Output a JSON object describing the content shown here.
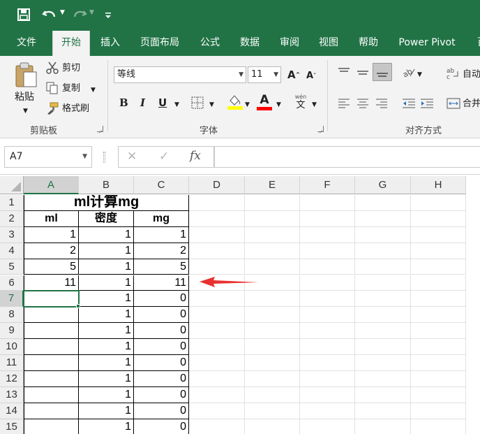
{
  "quick_access": {
    "save_icon": "save-icon",
    "undo_icon": "undo-icon",
    "redo_icon": "redo-icon",
    "customize_icon": "customize-qat-icon"
  },
  "tabs": [
    "文件",
    "开始",
    "插入",
    "页面布局",
    "公式",
    "数据",
    "审阅",
    "视图",
    "帮助",
    "Power Pivot",
    "百"
  ],
  "active_tab": "开始",
  "ribbon": {
    "clipboard": {
      "paste": "粘贴",
      "cut": "剪切",
      "copy": "复制",
      "format_painter": "格式刷",
      "label": "剪贴板"
    },
    "font": {
      "font_name": "等线",
      "font_size": "11",
      "bold": "B",
      "italic": "I",
      "underline": "U",
      "phonetic": "文",
      "phonetic_top": "wén",
      "label": "字体",
      "grow": "A",
      "shrink": "A",
      "font_color_letter": "A"
    },
    "alignment": {
      "wrap": "自动",
      "merge": "合并",
      "label": "对齐方式"
    },
    "colors": {
      "fill_highlight": "#ffff00",
      "font_color": "#ff0000"
    }
  },
  "formula_bar": {
    "name_box": "A7",
    "cancel": "✕",
    "enter": "✓",
    "fx": "fx",
    "formula": ""
  },
  "columns": [
    "A",
    "B",
    "C",
    "D",
    "E",
    "F",
    "G",
    "H"
  ],
  "rows": [
    "1",
    "2",
    "3",
    "4",
    "5",
    "6",
    "7",
    "8",
    "9",
    "10",
    "11",
    "12",
    "13",
    "14",
    "15"
  ],
  "sheet": {
    "title": "ml计算mg",
    "headers": [
      "ml",
      "密度",
      "mg"
    ],
    "data": [
      [
        "1",
        "1",
        "1"
      ],
      [
        "2",
        "1",
        "2"
      ],
      [
        "5",
        "1",
        "5"
      ],
      [
        "11",
        "1",
        "11"
      ],
      [
        "",
        "1",
        "0"
      ],
      [
        "",
        "1",
        "0"
      ],
      [
        "",
        "1",
        "0"
      ],
      [
        "",
        "1",
        "0"
      ],
      [
        "",
        "1",
        "0"
      ],
      [
        "",
        "1",
        "0"
      ],
      [
        "",
        "1",
        "0"
      ],
      [
        "",
        "1",
        "0"
      ],
      [
        "",
        "1",
        "0"
      ]
    ]
  },
  "selected_cell": "A7",
  "annotation_arrow_color": "#e8312f",
  "theme": {
    "accent": "#217346"
  }
}
